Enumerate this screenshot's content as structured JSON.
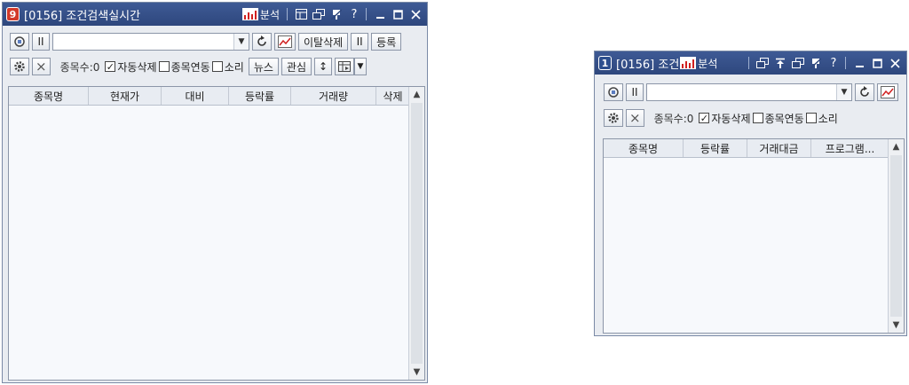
{
  "window1": {
    "number": "9",
    "title": "[0156] 조건검색실시간",
    "analyze_label": "분석",
    "help_label": "?",
    "buttons": {
      "exclude_delete": "이탈삭제",
      "register": "등록",
      "news": "뉴스",
      "interest": "관심"
    },
    "count_label": "종목수:0",
    "checkboxes": [
      {
        "label": "자동삭제",
        "checked": true
      },
      {
        "label": "종목연동",
        "checked": false
      },
      {
        "label": "소리",
        "checked": false
      }
    ],
    "columns": [
      "종목명",
      "현재가",
      "대비",
      "등락률",
      "거래량",
      "삭제"
    ]
  },
  "window2": {
    "number": "1",
    "title": "[0156] 조건",
    "analyze_label": "분석",
    "help_label": "?",
    "count_label": "종목수:0",
    "checkboxes": [
      {
        "label": "자동삭제",
        "checked": true
      },
      {
        "label": "종목연동",
        "checked": false
      },
      {
        "label": "소리",
        "checked": false
      }
    ],
    "columns": [
      "종목명",
      "등락률",
      "거래대금",
      "프로그램..."
    ]
  },
  "icons": {
    "pause": "II",
    "close": "×",
    "check": "✓",
    "dropdown": "▼",
    "scroll_up": "▲",
    "scroll_down": "▼",
    "updown": "↕"
  },
  "colors": {
    "title_bar": "#2e477d",
    "window_num_red": "#d23a2a",
    "window_num_blue": "#2d4f8e",
    "chart_red": "#d02020"
  }
}
